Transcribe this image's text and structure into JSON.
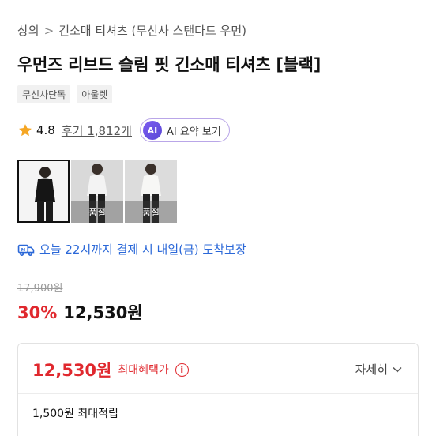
{
  "breadcrumb": {
    "items": [
      "상의",
      "긴소매 티셔츠 (무신사 스탠다드 우먼)"
    ],
    "separator": ">"
  },
  "product": {
    "title": "우먼즈 리브드 슬림 핏 긴소매 티셔츠 [블랙]",
    "tags": [
      "무신사단독",
      "아울렛"
    ]
  },
  "rating": {
    "value": "4.8",
    "review_link": "후기 1,812개",
    "ai_badge": "AI",
    "ai_label": "AI 요약 보기",
    "star_color": "#f5a623"
  },
  "thumbnails": [
    {
      "selected": true,
      "soldout_label": ""
    },
    {
      "selected": false,
      "soldout_label": "품절"
    },
    {
      "selected": false,
      "soldout_label": "품절"
    }
  ],
  "delivery": {
    "text": "오늘 22시까지 결제 시 내일(금) 도착보장",
    "color": "#2b68d8"
  },
  "price": {
    "original": "17,900원",
    "discount": "30%",
    "sale": "12,530원",
    "accent": "#e0282e"
  },
  "benefit": {
    "price": "12,530원",
    "label": "최대혜택가",
    "info_icon": "i",
    "detail": "자세히",
    "points": "1,500원 최대적립"
  }
}
